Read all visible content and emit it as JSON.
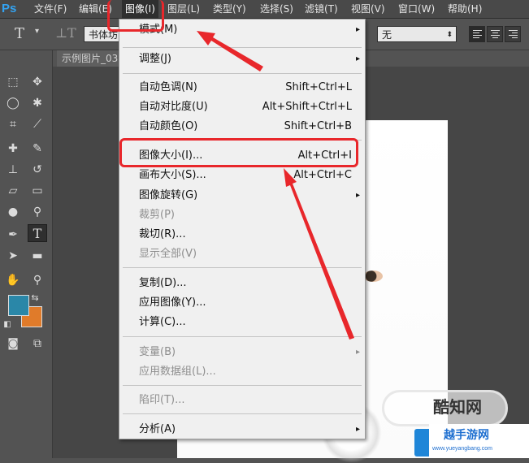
{
  "menubar": {
    "logo": "Ps",
    "items": [
      "文件(F)",
      "编辑(E)",
      "图像(I)",
      "图层(L)",
      "类型(Y)",
      "选择(S)",
      "滤镜(T)",
      "视图(V)",
      "窗口(W)",
      "帮助(H)"
    ]
  },
  "options": {
    "font_family": "书体坊",
    "aa_value": "无"
  },
  "document_tab": "示例图片_03",
  "image_menu": [
    {
      "label": "模式(M)",
      "submenu": true
    },
    {
      "label": "调整(J)",
      "submenu": true
    },
    {
      "label": "自动色调(N)",
      "shortcut": "Shift+Ctrl+L"
    },
    {
      "label": "自动对比度(U)",
      "shortcut": "Alt+Shift+Ctrl+L"
    },
    {
      "label": "自动颜色(O)",
      "shortcut": "Shift+Ctrl+B"
    },
    {
      "label": "图像大小(I)...",
      "shortcut": "Alt+Ctrl+I"
    },
    {
      "label": "画布大小(S)...",
      "shortcut": "Alt+Ctrl+C"
    },
    {
      "label": "图像旋转(G)",
      "submenu": true
    },
    {
      "label": "裁剪(P)",
      "disabled": true
    },
    {
      "label": "裁切(R)..."
    },
    {
      "label": "显示全部(V)",
      "disabled": true
    },
    {
      "label": "复制(D)..."
    },
    {
      "label": "应用图像(Y)..."
    },
    {
      "label": "计算(C)..."
    },
    {
      "label": "变量(B)",
      "disabled": true,
      "submenu": true
    },
    {
      "label": "应用数据组(L)...",
      "disabled": true
    },
    {
      "label": "陷印(T)...",
      "disabled": true
    },
    {
      "label": "分析(A)",
      "submenu": true
    }
  ],
  "watermark": {
    "brand": "酷知网",
    "site_title": "越手游网",
    "site_url": "www.yueyangbang.com"
  },
  "colors": {
    "foreground": "#2a87a8",
    "background": "#e07b2a",
    "annotation": "#e8272b"
  },
  "icons": {
    "submenu_arrow": "▸"
  }
}
